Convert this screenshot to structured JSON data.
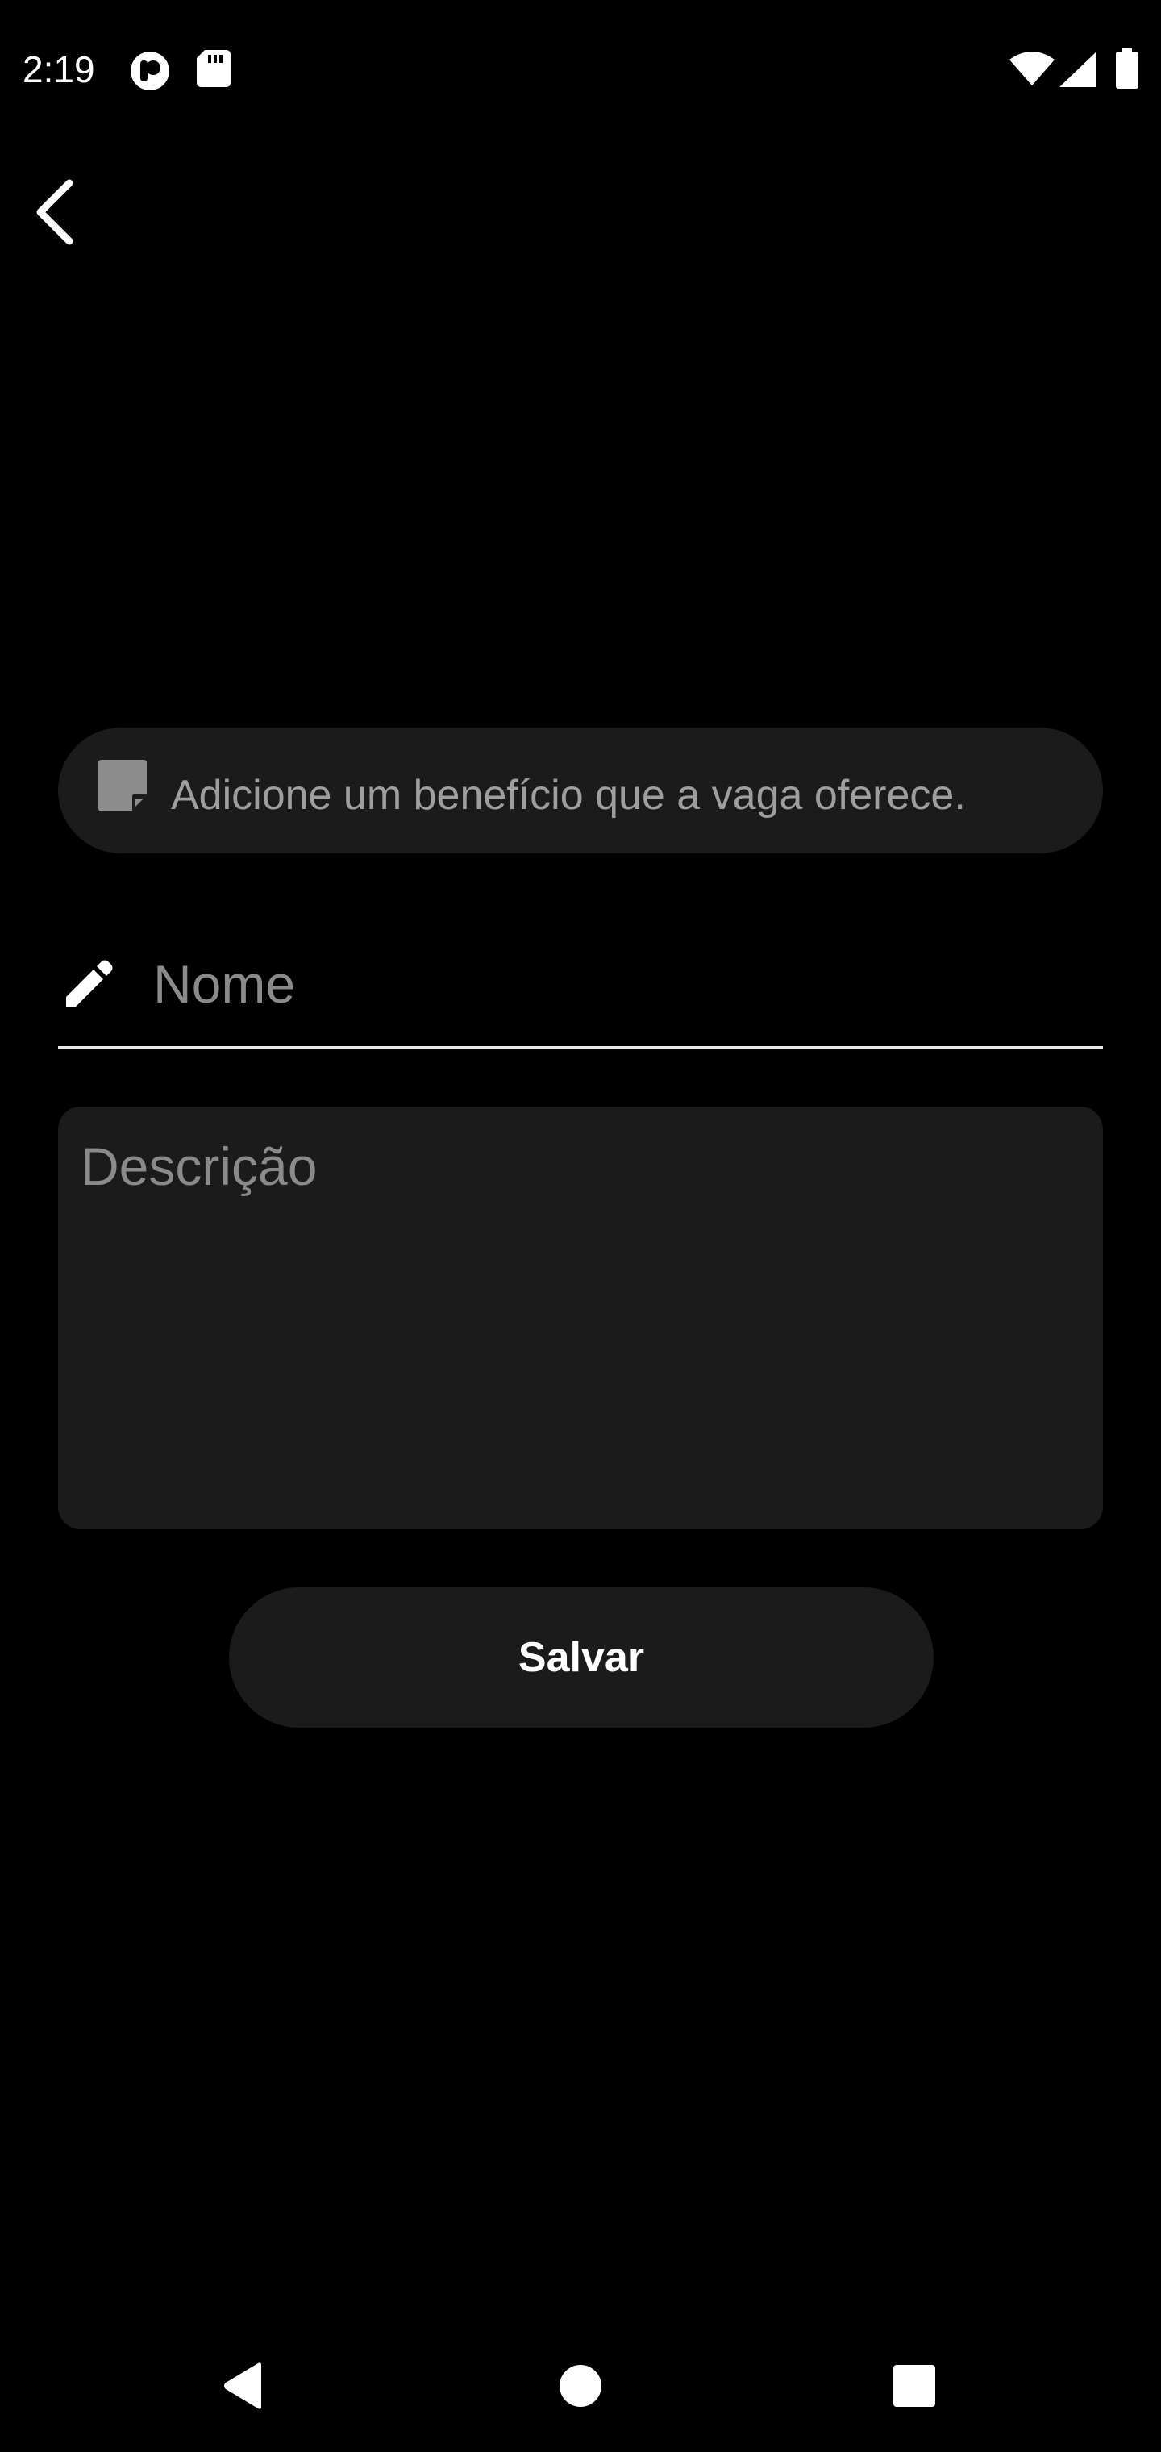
{
  "status_bar": {
    "time": "2:19",
    "left_icons": [
      "app-notification-icon",
      "sd-card-icon"
    ],
    "right_icons": [
      "wifi-icon",
      "cell-signal-icon",
      "battery-icon"
    ]
  },
  "header": {
    "back_icon": "back-arrow-icon"
  },
  "banner": {
    "icon": "sticky-note-icon",
    "text": "Adicione um benefício que a vaga oferece."
  },
  "form": {
    "name_placeholder": "Nome",
    "name_value": "",
    "name_icon": "pencil-icon",
    "description_placeholder": "Descrição",
    "description_value": "",
    "save_label": "Salvar"
  },
  "colors": {
    "background": "#000000",
    "surface": "#1b1b1b",
    "placeholder": "#8a8a8a",
    "text": "#ffffff"
  },
  "nav_bar": {
    "items": [
      "back-triangle-icon",
      "home-circle-icon",
      "recents-square-icon"
    ]
  }
}
